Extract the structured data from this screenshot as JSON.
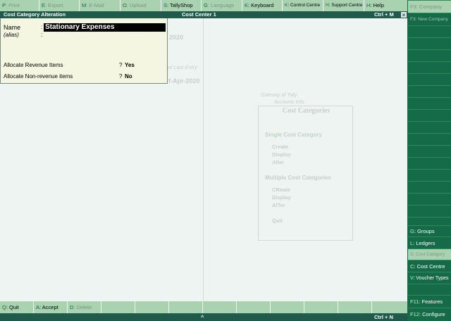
{
  "top_menu": [
    {
      "key": "P",
      "label": ": Print",
      "enabled": false
    },
    {
      "key": "E",
      "label": ": Export",
      "enabled": false
    },
    {
      "key": "M",
      "label": ": E-Mail",
      "enabled": false
    },
    {
      "key": "O",
      "label": ": Upload",
      "enabled": false
    },
    {
      "key": "S",
      "label": ": TallyShop",
      "enabled": true
    },
    {
      "key": "G",
      "label": ": Language",
      "enabled": false
    },
    {
      "key": "K",
      "label": ": Keyboard",
      "enabled": true
    },
    {
      "key": "K",
      "label": ": Control Centre",
      "enabled": true
    },
    {
      "key": "H",
      "label": ": Support Centre",
      "enabled": true
    },
    {
      "key": "H",
      "label": ": Help",
      "enabled": true
    }
  ],
  "title_bar": {
    "screen_title": "Cost Category Alteration",
    "company": "Cost Center 1",
    "shortcut": "Ctrl + M",
    "close_glyph": "×"
  },
  "form": {
    "name_label": "Name",
    "name_colon": ":",
    "name_value": "Stationary Expenses",
    "alias_label": "(alias)",
    "alias_colon": ":",
    "revenue_label": "Allocate Revenue Items",
    "revenue_q": "?",
    "revenue_value": "Yes",
    "nonrevenue_label": "Allocate Non-revenue items",
    "nonrevenue_q": "?",
    "nonrevenue_value": "No"
  },
  "background": {
    "year1": "2020",
    "last_entry": "of Last Entry",
    "date_frag": "f-Apr-2020",
    "gateway": "Gateway of Tally",
    "accounts_info": "Accounts Info.",
    "box_title": "Cost Categories",
    "single_heading": "Single Cost Category",
    "single_items": [
      "Create",
      "Display",
      "Alter"
    ],
    "multiple_heading": "Multiple Cost Categories",
    "multiple_items": [
      "CReate",
      "Display",
      "AlTer"
    ],
    "quit": "Quit"
  },
  "right_panel": [
    {
      "key": "F3",
      "label": ": Company",
      "enabled": false
    },
    {
      "key": "F3",
      "label": ": New Company",
      "enabled": false
    },
    {
      "key": "G",
      "label": ": Groups",
      "enabled": true
    },
    {
      "key": "L",
      "label": ": Ledgers",
      "enabled": true
    },
    {
      "key": "S",
      "label": ": Cost Category",
      "enabled": false
    },
    {
      "key": "C",
      "label": ": Cost Centre",
      "enabled": true
    },
    {
      "key": "V",
      "label": ": Voucher Types",
      "enabled": true
    },
    {
      "key": "F11",
      "label": ": Features",
      "enabled": true
    },
    {
      "key": "F12",
      "label": ": Configure",
      "enabled": true
    }
  ],
  "bottom_bar": [
    {
      "key": "Q",
      "label": ": Quit",
      "enabled": true
    },
    {
      "key": "A",
      "label": ": Accept",
      "enabled": true
    },
    {
      "key": "D",
      "label": ": Delete",
      "enabled": false
    }
  ],
  "status_bar": {
    "caret": "^",
    "shortcut": "Ctrl + N"
  },
  "colors": {
    "menu_bg": "#a9d2b1",
    "title_bg": "#1f5a4a",
    "panel_bg": "#156b48",
    "form_bg": "#f5f6e2"
  }
}
